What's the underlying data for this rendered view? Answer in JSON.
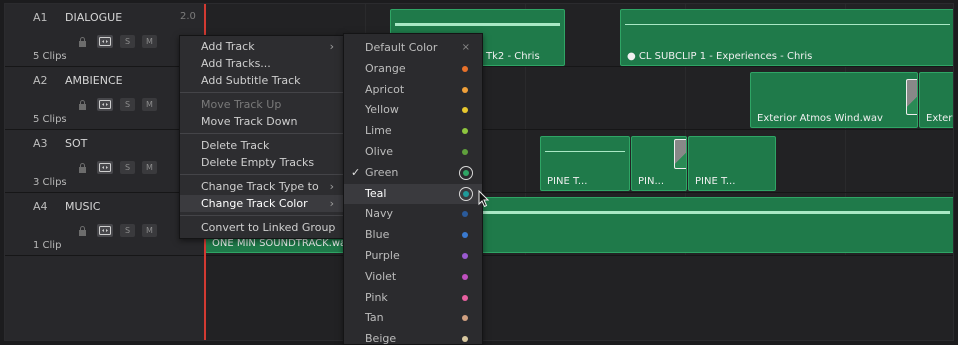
{
  "tracks": [
    {
      "id": "A1",
      "name": "DIALOGUE",
      "level": "2.0",
      "clips": "5 Clips"
    },
    {
      "id": "A2",
      "name": "AMBIENCE",
      "level": "",
      "clips": "5 Clips"
    },
    {
      "id": "A3",
      "name": "SOT",
      "level": "",
      "clips": "3 Clips"
    },
    {
      "id": "A4",
      "name": "MUSIC",
      "level": "",
      "clips": "1 Clip"
    }
  ],
  "track_controls": {
    "solo": "S",
    "mute": "M"
  },
  "clips": {
    "dialogue_1": "Tk2 - Chris",
    "dialogue_2": "● CL SUBCLIP 1 - Experiences - Chris",
    "ambience_1": "Exterior Atmos Wind.wav",
    "ambience_2": "Exterior",
    "sot_1": "PINE T...",
    "sot_2": "PIN...",
    "sot_3": "PINE T...",
    "music_1": "ONE MIN SOUNDTRACK.wav"
  },
  "context_menu": {
    "items": [
      {
        "label": "Add Track",
        "arrow": "›"
      },
      {
        "label": "Add Tracks...",
        "arrow": ""
      },
      {
        "label": "Add Subtitle Track",
        "arrow": ""
      },
      {
        "label": "Move Track Up",
        "arrow": ""
      },
      {
        "label": "Move Track Down",
        "arrow": ""
      },
      {
        "label": "Delete Track",
        "arrow": ""
      },
      {
        "label": "Delete Empty Tracks",
        "arrow": ""
      },
      {
        "label": "Change Track Type to",
        "arrow": "›"
      },
      {
        "label": "Change Track Color",
        "arrow": "›"
      },
      {
        "label": "Convert to Linked Group",
        "arrow": ""
      }
    ]
  },
  "color_menu": {
    "items": [
      {
        "label": "Default Color",
        "color": ""
      },
      {
        "label": "Orange",
        "color": "#e8712a"
      },
      {
        "label": "Apricot",
        "color": "#f0a03a"
      },
      {
        "label": "Yellow",
        "color": "#e8c82e"
      },
      {
        "label": "Lime",
        "color": "#8ec63f"
      },
      {
        "label": "Olive",
        "color": "#5fa03c"
      },
      {
        "label": "Green",
        "color": "#2fa565"
      },
      {
        "label": "Teal",
        "color": "#1f9a9a"
      },
      {
        "label": "Navy",
        "color": "#2a5a9a"
      },
      {
        "label": "Blue",
        "color": "#3a7ad0"
      },
      {
        "label": "Purple",
        "color": "#9a5ad0"
      },
      {
        "label": "Violet",
        "color": "#c050c0"
      },
      {
        "label": "Pink",
        "color": "#e860a0"
      },
      {
        "label": "Tan",
        "color": "#d0a080"
      },
      {
        "label": "Beige",
        "color": "#d8c8a0"
      }
    ],
    "checked": "Green",
    "highlighted": "Teal",
    "close_glyph": "×",
    "check_glyph": "✓"
  },
  "colors": {
    "clip_green": "#1f7a4a",
    "playhead": "#d23a32"
  }
}
